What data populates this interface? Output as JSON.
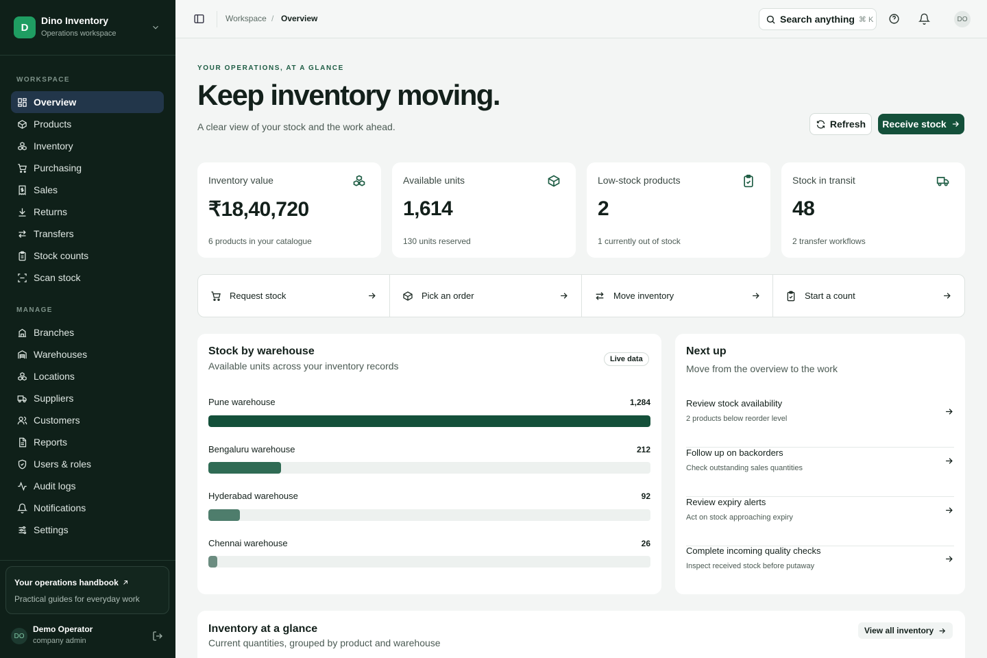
{
  "brand": {
    "initial": "D",
    "name": "Dino Inventory",
    "subtitle": "Operations workspace"
  },
  "sidebar": {
    "workspace_label": "WORKSPACE",
    "manage_label": "MANAGE",
    "workspace_items": [
      {
        "label": "Overview",
        "icon": "grid-icon",
        "active": true
      },
      {
        "label": "Products",
        "icon": "box-icon"
      },
      {
        "label": "Inventory",
        "icon": "boxes-icon"
      },
      {
        "label": "Purchasing",
        "icon": "cart-icon"
      },
      {
        "label": "Sales",
        "icon": "receipt-icon"
      },
      {
        "label": "Returns",
        "icon": "download-icon"
      },
      {
        "label": "Transfers",
        "icon": "arrows-icon"
      },
      {
        "label": "Stock counts",
        "icon": "clipboard-icon"
      },
      {
        "label": "Scan stock",
        "icon": "scan-icon"
      }
    ],
    "manage_items": [
      {
        "label": "Branches",
        "icon": "building-icon"
      },
      {
        "label": "Warehouses",
        "icon": "warehouse-icon"
      },
      {
        "label": "Locations",
        "icon": "boxes-icon"
      },
      {
        "label": "Suppliers",
        "icon": "truck-icon"
      },
      {
        "label": "Customers",
        "icon": "users-icon"
      },
      {
        "label": "Reports",
        "icon": "file-icon"
      },
      {
        "label": "Users & roles",
        "icon": "shield-icon"
      },
      {
        "label": "Audit logs",
        "icon": "activity-icon"
      },
      {
        "label": "Notifications",
        "icon": "bell-icon"
      },
      {
        "label": "Settings",
        "icon": "sliders-icon"
      }
    ],
    "handbook": {
      "title": "Your operations handbook",
      "subtitle": "Practical guides for everyday work"
    },
    "user": {
      "initials": "DO",
      "name": "Demo Operator",
      "role": "company admin"
    }
  },
  "topbar": {
    "breadcrumb": [
      "Workspace",
      "Overview"
    ],
    "separator": "/",
    "search_label": "Search anything",
    "search_shortcut": "⌘ K",
    "avatar_initials": "DO"
  },
  "hero": {
    "eyebrow": "YOUR OPERATIONS, AT A GLANCE",
    "title": "Keep inventory moving.",
    "subtitle": "A clear view of your stock and the work ahead.",
    "refresh_label": "Refresh",
    "receive_label": "Receive stock"
  },
  "kpis": [
    {
      "label": "Inventory value",
      "value": "₹18,40,720",
      "note": "6 products in your catalogue",
      "icon": "boxes-icon"
    },
    {
      "label": "Available units",
      "value": "1,614",
      "note": "130 units reserved",
      "icon": "box-icon"
    },
    {
      "label": "Low-stock products",
      "value": "2",
      "note": "1 currently out of stock",
      "icon": "clipboard-check-icon"
    },
    {
      "label": "Stock in transit",
      "value": "48",
      "note": "2 transfer workflows",
      "icon": "truck-icon"
    }
  ],
  "quick_actions": [
    {
      "label": "Request stock",
      "icon": "cart-icon"
    },
    {
      "label": "Pick an order",
      "icon": "box-icon"
    },
    {
      "label": "Move inventory",
      "icon": "arrows-icon"
    },
    {
      "label": "Start a count",
      "icon": "clipboard-check-icon"
    }
  ],
  "warehouses": {
    "title": "Stock by warehouse",
    "subtitle": "Available units across your inventory records",
    "badge": "Live data",
    "max": 1284,
    "items": [
      {
        "name": "Pune warehouse",
        "value": 1284,
        "display": "1,284",
        "color": "#14503a"
      },
      {
        "name": "Bengaluru warehouse",
        "value": 212,
        "display": "212",
        "color": "#2f6b54"
      },
      {
        "name": "Hyderabad warehouse",
        "value": 92,
        "display": "92",
        "color": "#4e7d6c"
      },
      {
        "name": "Chennai warehouse",
        "value": 26,
        "display": "26",
        "color": "#6b8c80"
      }
    ]
  },
  "next_up": {
    "title": "Next up",
    "subtitle": "Move from the overview to the work",
    "items": [
      {
        "title": "Review stock availability",
        "subtitle": "2 products below reorder level"
      },
      {
        "title": "Follow up on backorders",
        "subtitle": "Check outstanding sales quantities"
      },
      {
        "title": "Review expiry alerts",
        "subtitle": "Act on stock approaching expiry"
      },
      {
        "title": "Complete incoming quality checks",
        "subtitle": "Inspect received stock before putaway"
      }
    ]
  },
  "glance": {
    "title": "Inventory at a glance",
    "subtitle": "Current quantities, grouped by product and warehouse",
    "view_all_label": "View all inventory"
  }
}
